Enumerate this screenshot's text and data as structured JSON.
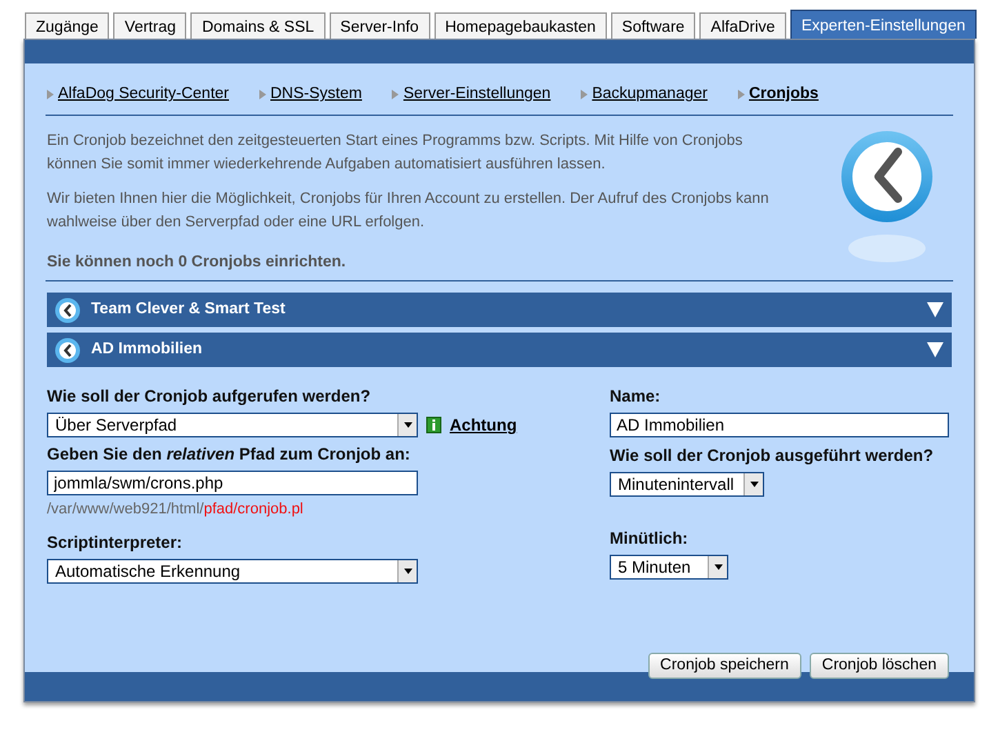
{
  "tabs": [
    {
      "label": "Zugänge",
      "selected": false
    },
    {
      "label": "Vertrag",
      "selected": false
    },
    {
      "label": "Domains & SSL",
      "selected": false
    },
    {
      "label": "Server-Info",
      "selected": false
    },
    {
      "label": "Homepagebaukasten",
      "selected": false
    },
    {
      "label": "Software",
      "selected": false
    },
    {
      "label": "AlfaDrive",
      "selected": false
    },
    {
      "label": "Experten-Einstellungen",
      "selected": true
    }
  ],
  "subnav": [
    {
      "label": "AlfaDog Security-Center",
      "selected": false
    },
    {
      "label": "DNS-System",
      "selected": false
    },
    {
      "label": "Server-Einstellungen",
      "selected": false
    },
    {
      "label": "Backupmanager",
      "selected": false
    },
    {
      "label": "Cronjobs",
      "selected": true
    }
  ],
  "intro": [
    "Ein Cronjob bezeichnet den zeitgesteuerten Start eines Programms bzw. Scripts. Mit Hilfe von Cronjobs können Sie somit immer wiederkehrende Aufgaben automatisiert ausführen lassen.",
    "Wir bieten Ihnen hier die Möglichkeit, Cronjobs für Ihren Account zu erstellen. Der Aufruf des Cronjobs kann wahlweise über den Serverpfad oder eine URL erfolgen."
  ],
  "remaining": "Sie können noch 0 Cronjobs einrichten.",
  "cronjobs": [
    {
      "title": "Team Clever & Smart Test"
    },
    {
      "title": "AD Immobilien"
    }
  ],
  "form": {
    "call_label": "Wie soll der Cronjob aufgerufen werden?",
    "call_value": "Über Serverpfad",
    "info_link": "Achtung",
    "path_label": "Geben Sie den *relativen* Pfad zum Cronjob an:",
    "path_value": "jommla/swm/crons.php",
    "path_hint_base": "/var/www/web921/html/",
    "path_hint_example": "pfad/cronjob.pl",
    "interpreter_label": "Scriptinterpreter:",
    "interpreter_value": "Automatische Erkennung",
    "name_label": "Name:",
    "name_value": "AD Immobilien",
    "mode_label": "Wie soll der Cronjob ausgeführt werden?",
    "mode_value": "Minutenintervall",
    "interval_label": "Minütlich:",
    "interval_value": "5 Minuten"
  },
  "buttons": [
    "Cronjob speichern",
    "Cronjob löschen"
  ]
}
